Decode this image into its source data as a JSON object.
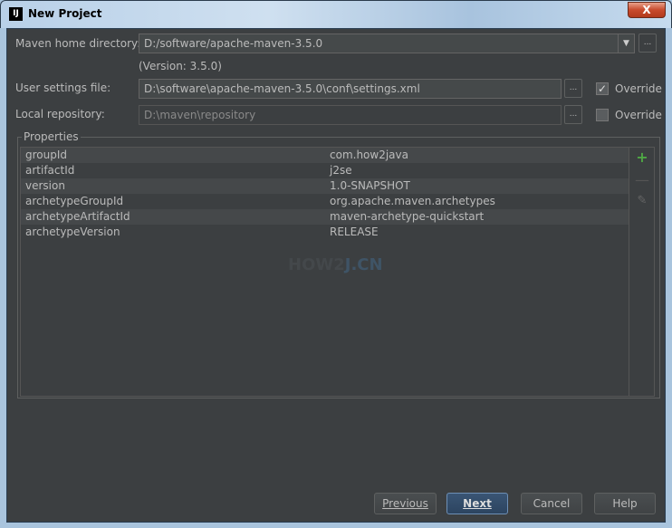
{
  "window": {
    "title": "New Project",
    "app_icon": "IJ",
    "close_label": "X"
  },
  "form": {
    "maven_home": {
      "label": "Maven home directory:",
      "value": "D:/software/apache-maven-3.5.0",
      "version": "(Version: 3.5.0)"
    },
    "user_settings": {
      "label": "User settings file:",
      "value": "D:\\software\\apache-maven-3.5.0\\conf\\settings.xml",
      "override_label": "Override",
      "override_checked": true
    },
    "local_repo": {
      "label": "Local repository:",
      "value": "D:\\maven\\repository",
      "override_label": "Override",
      "override_checked": false
    },
    "browse_label": "..."
  },
  "properties": {
    "title": "Properties",
    "rows": [
      {
        "key": "groupId",
        "value": "com.how2java"
      },
      {
        "key": "artifactId",
        "value": "j2se"
      },
      {
        "key": "version",
        "value": "1.0-SNAPSHOT"
      },
      {
        "key": "archetypeGroupId",
        "value": "org.apache.maven.archetypes"
      },
      {
        "key": "archetypeArtifactId",
        "value": "maven-archetype-quickstart"
      },
      {
        "key": "archetypeVersion",
        "value": "RELEASE"
      }
    ],
    "tools": [
      "plus-icon",
      "minus-icon",
      "pencil-icon"
    ]
  },
  "watermark": "HOW2J.CN",
  "buttons": {
    "previous": "Previous",
    "next": "Next",
    "cancel": "Cancel",
    "help": "Help"
  },
  "colors": {
    "add": "#4fa745",
    "background": "#3c3f41",
    "default_button": "#2c4460"
  }
}
